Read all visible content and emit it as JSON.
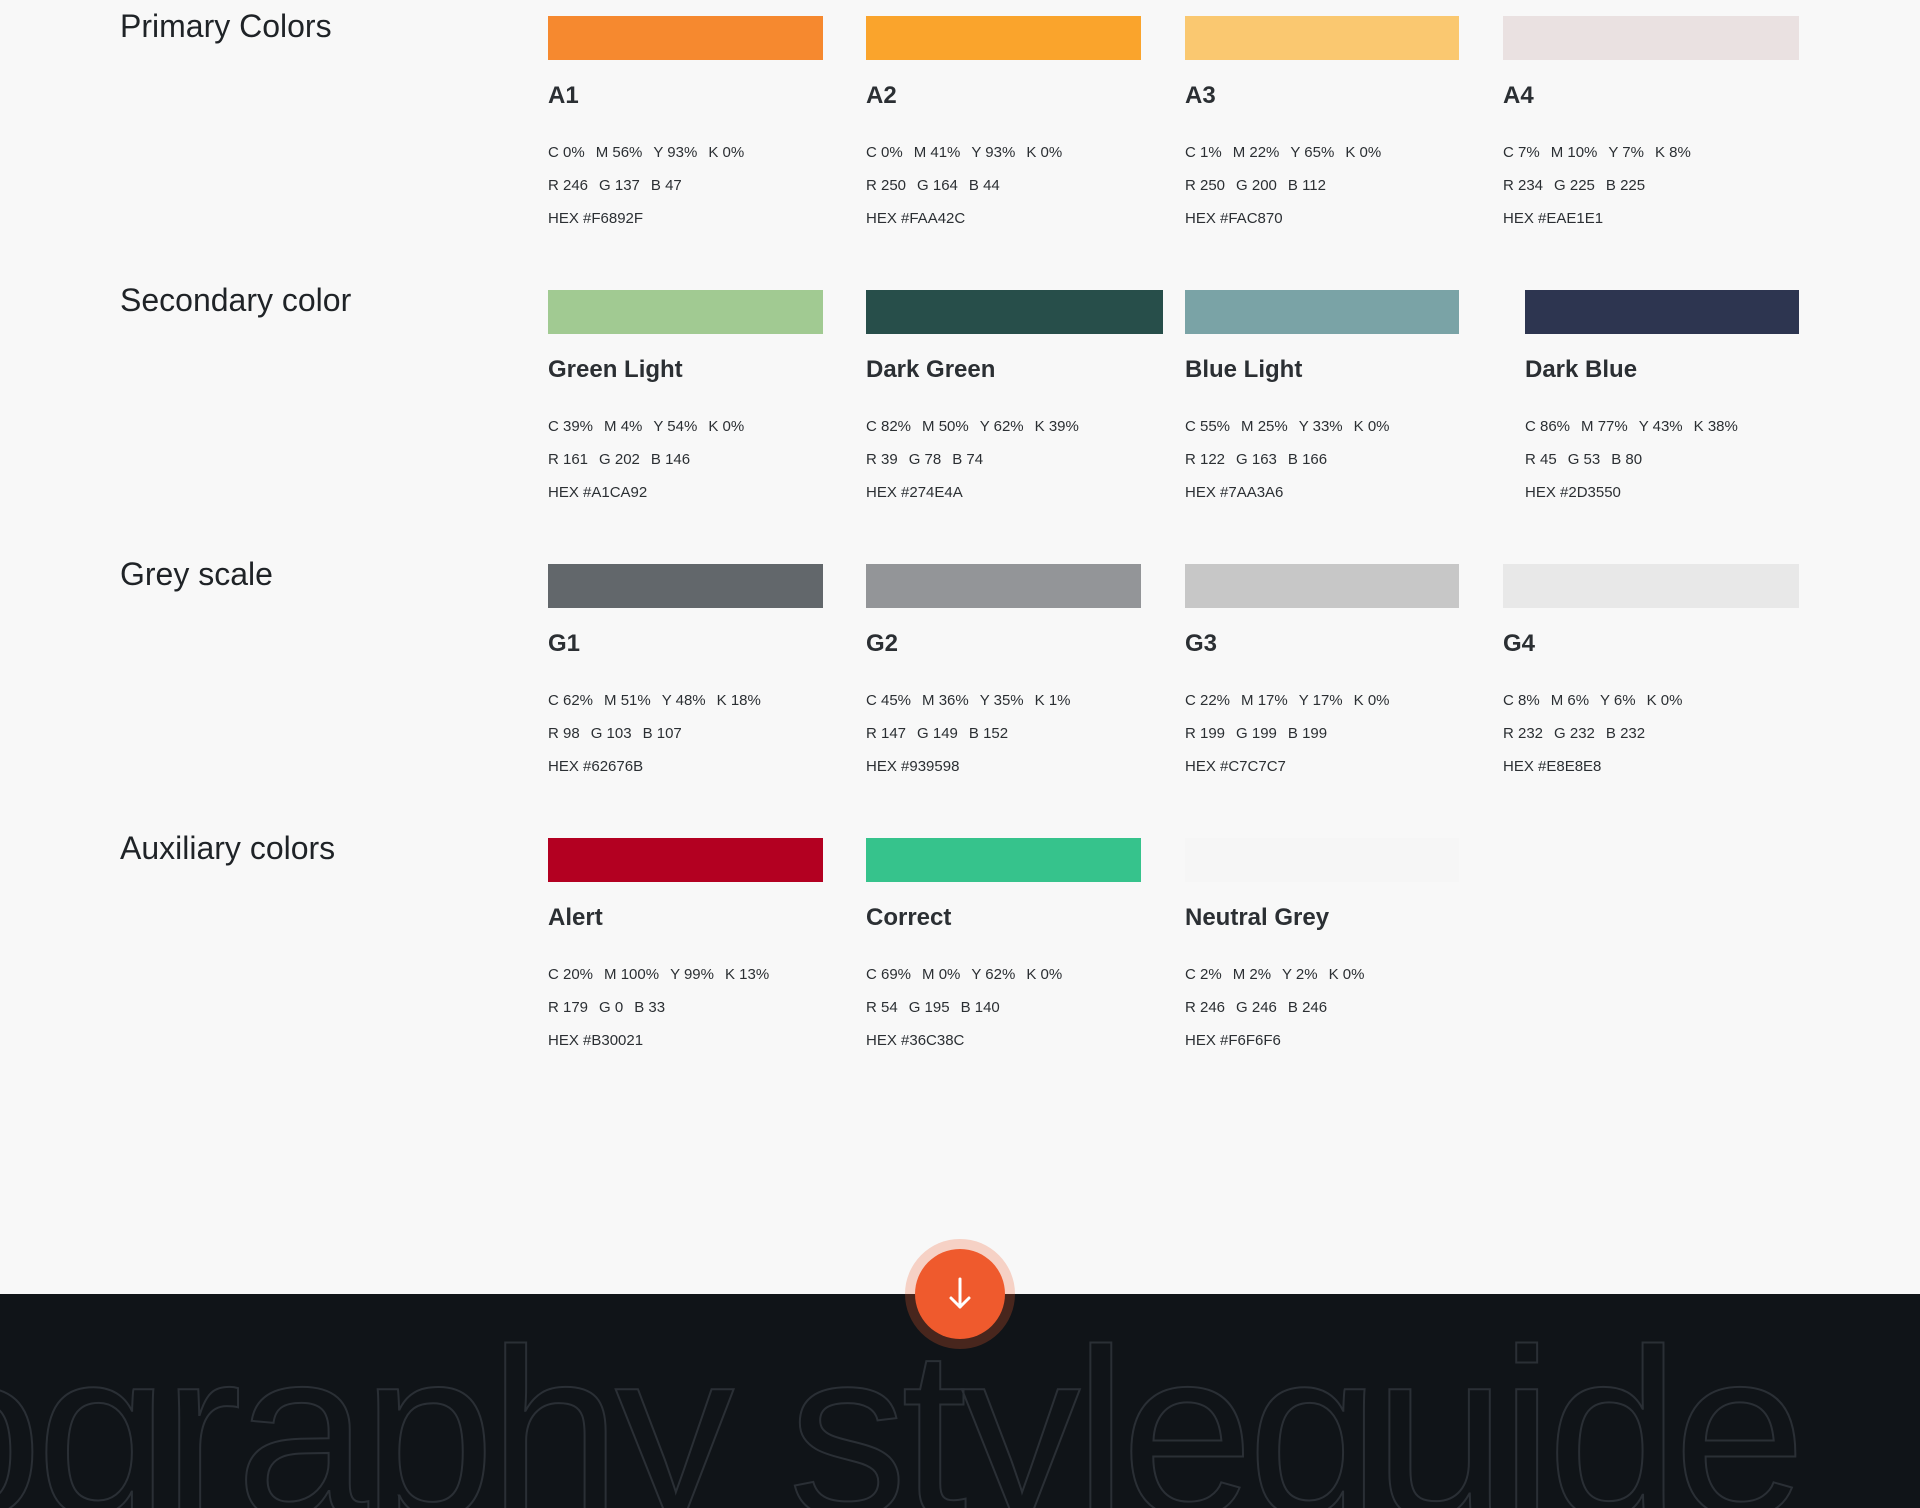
{
  "sections": [
    {
      "title": "Primary Colors",
      "swatches": [
        {
          "name": "A1",
          "color": "#F6892F",
          "cmyk": [
            "C 0%",
            "M 56%",
            "Y 93%",
            "K 0%"
          ],
          "rgb": [
            "R 246",
            "G 137",
            "B 47"
          ],
          "hex": "HEX #F6892F"
        },
        {
          "name": "A2",
          "color": "#FAA42C",
          "cmyk": [
            "C 0%",
            "M 41%",
            "Y 93%",
            "K 0%"
          ],
          "rgb": [
            "R 250",
            "G 164",
            "B 44"
          ],
          "hex": "HEX #FAA42C"
        },
        {
          "name": "A3",
          "color": "#FAC870",
          "cmyk": [
            "C 1%",
            "M 22%",
            "Y 65%",
            "K 0%"
          ],
          "rgb": [
            "R 250",
            "G 200",
            "B 112"
          ],
          "hex": "HEX #FAC870"
        },
        {
          "name": "A4",
          "color": "#EAE1E1",
          "cmyk": [
            "C 7%",
            "M 10%",
            "Y 7%",
            "K 8%"
          ],
          "rgb": [
            "R 234",
            "G 225",
            "B 225"
          ],
          "hex": "HEX #EAE1E1"
        }
      ]
    },
    {
      "title": "Secondary color",
      "swatches": [
        {
          "name": "Green Light",
          "color": "#A1CA92",
          "cmyk": [
            "C 39%",
            "M 4%",
            "Y 54%",
            "K 0%"
          ],
          "rgb": [
            "R 161",
            "G 202",
            "B 146"
          ],
          "hex": "HEX #A1CA92"
        },
        {
          "name": "Dark Green",
          "color": "#274E4A",
          "cmyk": [
            "C 82%",
            "M 50%",
            "Y 62%",
            "K 39%"
          ],
          "rgb": [
            "R 39",
            "G 78",
            "B 74"
          ],
          "hex": "HEX #274E4A"
        },
        {
          "name": "Blue Light",
          "color": "#7AA3A6",
          "cmyk": [
            "C 55%",
            "M 25%",
            "Y 33%",
            "K 0%"
          ],
          "rgb": [
            "R 122",
            "G 163",
            "B 166"
          ],
          "hex": "HEX #7AA3A6"
        },
        {
          "name": "Dark Blue",
          "color": "#2D3550",
          "cmyk": [
            "C 86%",
            "M 77%",
            "Y 43%",
            "K 38%"
          ],
          "rgb": [
            "R 45",
            "G 53",
            "B 80"
          ],
          "hex": "HEX #2D3550"
        }
      ]
    },
    {
      "title": "Grey scale",
      "swatches": [
        {
          "name": "G1",
          "color": "#62676B",
          "cmyk": [
            "C 62%",
            "M 51%",
            "Y 48%",
            "K 18%"
          ],
          "rgb": [
            "R 98",
            "G 103",
            "B 107"
          ],
          "hex": "HEX #62676B"
        },
        {
          "name": "G2",
          "color": "#939598",
          "cmyk": [
            "C 45%",
            "M 36%",
            "Y 35%",
            "K 1%"
          ],
          "rgb": [
            "R 147",
            "G 149",
            "B 152"
          ],
          "hex": "HEX #939598"
        },
        {
          "name": "G3",
          "color": "#C7C7C7",
          "cmyk": [
            "C 22%",
            "M 17%",
            "Y 17%",
            "K 0%"
          ],
          "rgb": [
            "R 199",
            "G 199",
            "B 199"
          ],
          "hex": "HEX #C7C7C7"
        },
        {
          "name": "G4",
          "color": "#E8E8E8",
          "cmyk": [
            "C 8%",
            "M 6%",
            "Y 6%",
            "K 0%"
          ],
          "rgb": [
            "R 232",
            "G 232",
            "B 232"
          ],
          "hex": "HEX #E8E8E8"
        }
      ]
    },
    {
      "title": "Auxiliary colors",
      "swatches": [
        {
          "name": "Alert",
          "color": "#B30021",
          "cmyk": [
            "C 20%",
            "M 100%",
            "Y 99%",
            "K 13%"
          ],
          "rgb": [
            "R 179",
            "G 0",
            "B 33"
          ],
          "hex": "HEX #B30021"
        },
        {
          "name": "Correct",
          "color": "#36C38C",
          "cmyk": [
            "C 69%",
            "M 0%",
            "Y 62%",
            "K 0%"
          ],
          "rgb": [
            "R 54",
            "G 195",
            "B 140"
          ],
          "hex": "HEX #36C38C"
        },
        {
          "name": "Neutral Grey",
          "color": "#F6F6F6",
          "cmyk": [
            "C 2%",
            "M 2%",
            "Y 2%",
            "K 0%"
          ],
          "rgb": [
            "R 246",
            "G 246",
            "B 246"
          ],
          "hex": "HEX #F6F6F6"
        }
      ]
    }
  ],
  "footer": {
    "background_text": "ography styleguide",
    "background_color": "#101418",
    "outline_color": "#2a2f35"
  },
  "scroll_button": {
    "icon": "arrow-down-icon",
    "color": "#EF5A2D"
  }
}
